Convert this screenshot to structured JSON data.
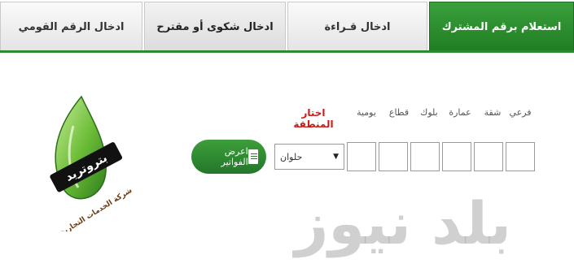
{
  "tabs": [
    {
      "label": "استعلام برقم المشترك",
      "active": true
    },
    {
      "label": "ادخال قـراءة",
      "active": false
    },
    {
      "label": "ادخال شكوى أو مقترح",
      "active": false
    },
    {
      "label": "ادخال الرقم القومي",
      "active": false
    }
  ],
  "form": {
    "region_label": "اختار المنطقة",
    "fields": [
      "فرعي",
      "شقة",
      "عمارة",
      "بلوك",
      "قطاع",
      "يومية"
    ],
    "region_selected": "حلوان",
    "show_button": "اعرض الفواتير"
  },
  "logo": {
    "brand": "بتروتريد",
    "company": "شركة الخدمات التجارية البترولية"
  },
  "watermark": "بلد نيوز",
  "colors": {
    "accent_green": "#2a8a2d",
    "region_red": "#c61b1b"
  }
}
